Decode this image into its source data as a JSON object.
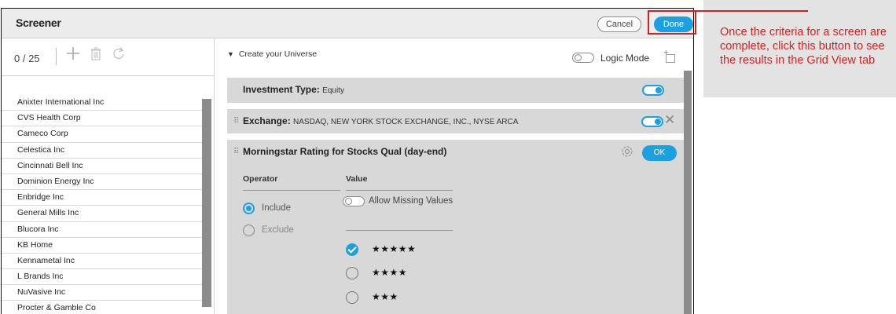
{
  "header": {
    "title": "Screener",
    "cancel_label": "Cancel",
    "done_label": "Done"
  },
  "left_panel": {
    "count": "0 / 25",
    "tools": [
      "add-icon",
      "delete-icon",
      "refresh-icon"
    ],
    "companies": [
      "Anixter International Inc",
      "CVS Health Corp",
      "Cameco Corp",
      "Celestica Inc",
      "Cincinnati Bell Inc",
      "Dominion Energy Inc",
      "Enbridge Inc",
      "General Mills Inc",
      "Blucora Inc",
      "KB Home",
      "Kennametal Inc",
      "L Brands Inc",
      "NuVasive Inc",
      "Procter & Gamble Co"
    ]
  },
  "universe": {
    "header": "Create your Universe",
    "logic_mode_label": "Logic Mode"
  },
  "criteria": [
    {
      "name": "Investment Type:",
      "value": "Equity"
    },
    {
      "name": "Exchange:",
      "value": "NASDAQ, NEW YORK STOCK EXCHANGE, INC., NYSE ARCA"
    },
    {
      "name": "Morningstar Rating for Stocks Qual (day-end)",
      "value": ""
    }
  ],
  "rating_criterion": {
    "ok_label": "OK",
    "operator_header": "Operator",
    "value_header": "Value",
    "include_label": "Include",
    "exclude_label": "Exclude",
    "allow_missing_label": "Allow Missing Values",
    "star_options": [
      "★★★★★",
      "★★★★",
      "★★★",
      "★★"
    ]
  },
  "callout": {
    "text": "Once the criteria for a screen are complete, click this button to see the results in the Grid View tab"
  },
  "colors": {
    "accent": "#1ba1e2",
    "callout_red": "#d81f1f",
    "panel_gray": "#d8d8d8"
  }
}
